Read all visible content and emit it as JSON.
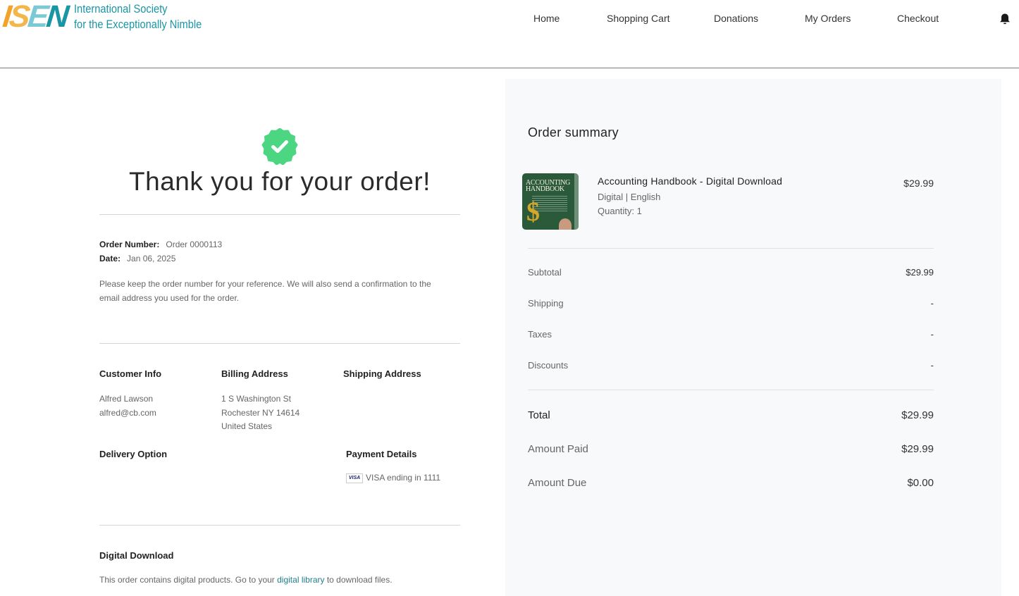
{
  "header": {
    "logo_mark": [
      "I",
      "S",
      "E",
      "N"
    ],
    "logo_line1": "International Society",
    "logo_line2": "for the Exceptionally Nimble",
    "nav": [
      {
        "label": "Home"
      },
      {
        "label": "Shopping Cart"
      },
      {
        "label": "Donations"
      },
      {
        "label": "My Orders"
      },
      {
        "label": "Checkout"
      }
    ],
    "notification_icon": "bell-icon"
  },
  "confirmation": {
    "status_icon": "check-badge-icon",
    "status_color": "#4cd682",
    "title": "Thank you for your order!",
    "order_number_label": "Order Number:",
    "order_number_value": "Order 0000113",
    "date_label": "Date:",
    "date_value": "Jan 06, 2025",
    "note": "Please keep the order number for your reference. We will also send a confirmation to the email address you used for the order."
  },
  "details": {
    "customer_info": {
      "heading": "Customer Info",
      "name": "Alfred Lawson",
      "email": "alfred@cb.com"
    },
    "billing_address": {
      "heading": "Billing Address",
      "line1": "1 S Washington St",
      "line2": "Rochester NY 14614",
      "line3": "United States"
    },
    "shipping_address": {
      "heading": "Shipping Address"
    },
    "delivery_option": {
      "heading": "Delivery Option"
    },
    "payment_details": {
      "heading": "Payment Details",
      "card_brand": "VISA",
      "card_text": "VISA ending in 1111"
    },
    "digital_download": {
      "heading": "Digital Download",
      "text_before": "This order contains digital products. Go to your ",
      "link_text": "digital library",
      "text_after": " to download files."
    }
  },
  "summary": {
    "title": "Order summary",
    "item": {
      "name": "Accounting Handbook - Digital Download",
      "variant": "Digital | English",
      "quantity": "Quantity: 1",
      "price": "$29.99",
      "thumb_title_1": "ACCOUNTING",
      "thumb_title_2": "HANDBOOK"
    },
    "lines": [
      {
        "label": "Subtotal",
        "value": "$29.99"
      },
      {
        "label": "Shipping",
        "value": "-"
      },
      {
        "label": "Taxes",
        "value": "-"
      },
      {
        "label": "Discounts",
        "value": "-"
      }
    ],
    "totals": [
      {
        "label": "Total",
        "value": "$29.99"
      },
      {
        "label": "Amount Paid",
        "value": "$29.99"
      },
      {
        "label": "Amount Due",
        "value": "$0.00"
      }
    ]
  }
}
